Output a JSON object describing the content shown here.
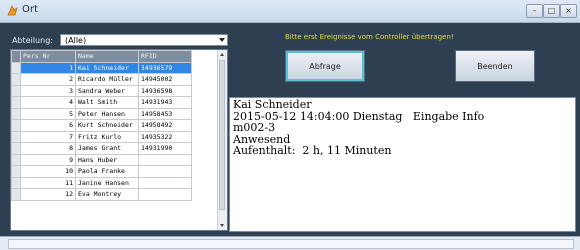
{
  "window": {
    "title": "Ort"
  },
  "filter": {
    "label": "Abteilung:",
    "value": "(Alle)"
  },
  "hint": "Bitte erst Ereignisse vom Controller übertragen!",
  "buttons": {
    "query": "Abfrage",
    "exit": "Beenden"
  },
  "grid": {
    "columns": [
      "Pers Nr",
      "Name",
      "RFID"
    ],
    "rows": [
      {
        "nr": "1",
        "name": "Kai Schneider",
        "rfid": "14936579",
        "selected": true
      },
      {
        "nr": "2",
        "name": "Ricardo Müller",
        "rfid": "14945002"
      },
      {
        "nr": "3",
        "name": "Sandra Weber",
        "rfid": "14936598"
      },
      {
        "nr": "4",
        "name": "Walt Smith",
        "rfid": "14931943"
      },
      {
        "nr": "5",
        "name": "Peter Hansen",
        "rfid": "14958453"
      },
      {
        "nr": "6",
        "name": "Kurt Schneider",
        "rfid": "14958492"
      },
      {
        "nr": "7",
        "name": "Fritz Kurlo",
        "rfid": "14935322"
      },
      {
        "nr": "8",
        "name": "James Grant",
        "rfid": "14931990"
      },
      {
        "nr": "9",
        "name": "Hans Huber",
        "rfid": ""
      },
      {
        "nr": "10",
        "name": "Paola Franke",
        "rfid": ""
      },
      {
        "nr": "11",
        "name": "Janine Hansen",
        "rfid": ""
      },
      {
        "nr": "12",
        "name": "Eva Montrey",
        "rfid": ""
      }
    ]
  },
  "info": {
    "lines": [
      "Kai Schneider",
      "2015-05-12 14:04:00 Dienstag   Eingabe Info",
      "m002-3",
      "Anwesend",
      "Aufenthalt:  2 h, 11 Minuten"
    ]
  },
  "colors": {
    "hint": "#e8d84a",
    "selection": "#2f86e4",
    "background": "#2e3f52"
  }
}
